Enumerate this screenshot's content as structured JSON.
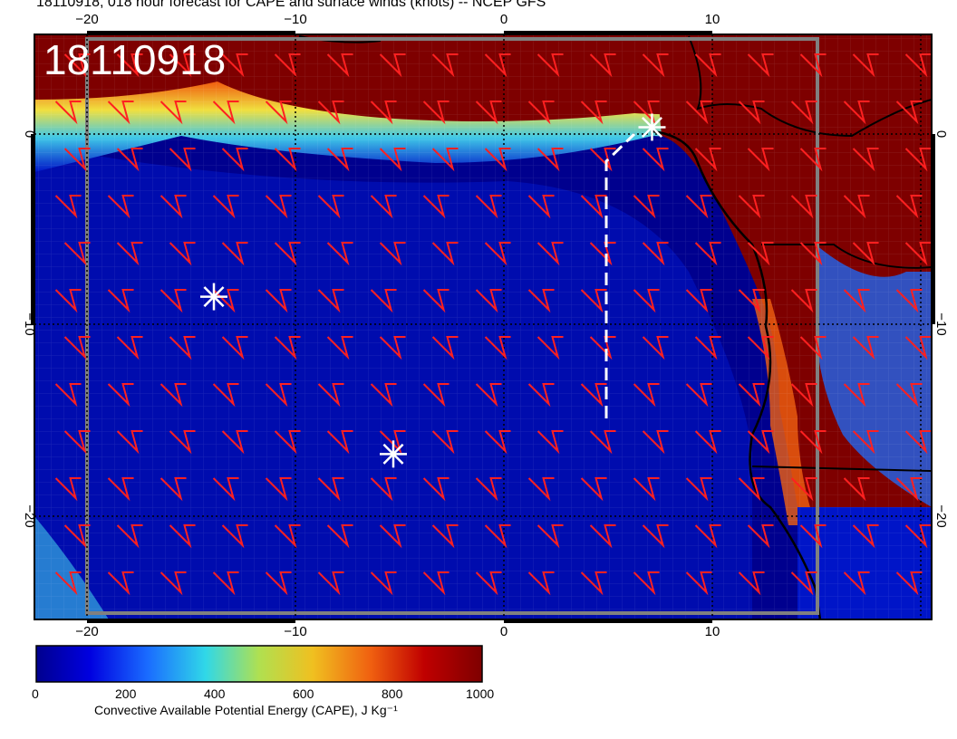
{
  "title": "18110918, 018 hour forecast for CAPE and surface winds (knots) -- NCEP GFS",
  "stamp": "18110918",
  "map": {
    "extent": {
      "lon": [
        -23,
        20
      ],
      "lat": [
        -24,
        5
      ]
    },
    "lon_ticks_top": [
      "−20",
      "−10",
      "0",
      "10"
    ],
    "lon_ticks_bottom": [
      "−20",
      "−10",
      "0",
      "10"
    ],
    "lat_ticks_left": [
      "0",
      "−10",
      "−20"
    ],
    "lat_ticks_right": [
      "0",
      "−10",
      "−20"
    ],
    "field": "CAPE",
    "wind_barb_color": "#ff2020",
    "marker_color": "#ffffff",
    "markers": [
      {
        "name": "marker-1",
        "lon": 6.6,
        "lat": 0.4
      },
      {
        "name": "marker-2",
        "lon": -14.4,
        "lat": -8.0
      },
      {
        "name": "marker-3",
        "lon": -5.8,
        "lat": -15.8
      }
    ],
    "flight_track": "dashed white line",
    "colors": {
      "ocean_low": "#00008e",
      "ocean_mid": "#0015c8",
      "transition_cyan": "#40c8e8",
      "high_cape": "#7e0000",
      "coastline": "#000000",
      "grid": "#ffffff"
    }
  },
  "colorbar": {
    "min": 0,
    "max": 1000,
    "ticks": [
      "0",
      "200",
      "400",
      "600",
      "800",
      "1000"
    ],
    "label": "Convective Available Potential Energy (CAPE), J Kg⁻¹",
    "stops": [
      "#00008e",
      "#0000e0",
      "#1a6cff",
      "#30d8e8",
      "#b0e050",
      "#f0c020",
      "#f06010",
      "#c00000",
      "#7e0000"
    ]
  }
}
